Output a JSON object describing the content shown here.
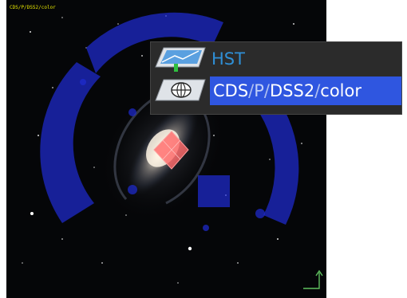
{
  "view": {
    "survey_label": "CDS/P/DSS2/color",
    "bottom_left_label": "",
    "bottom_center_label": ""
  },
  "layers": [
    {
      "icon": "hst-image-layer-icon",
      "name": "HST",
      "selected": false
    },
    {
      "icon": "allsky-survey-layer-icon",
      "path": [
        "CDS",
        "P",
        "DSS2",
        "color"
      ],
      "separator": "/",
      "selected": true
    }
  ],
  "colors": {
    "selection": "#2f56e0",
    "hst_label": "#2f8fd6",
    "footprint_blue": "#1e2bd0",
    "footprint_red": "#ff6a6a",
    "survey_label": "#e6e600"
  }
}
